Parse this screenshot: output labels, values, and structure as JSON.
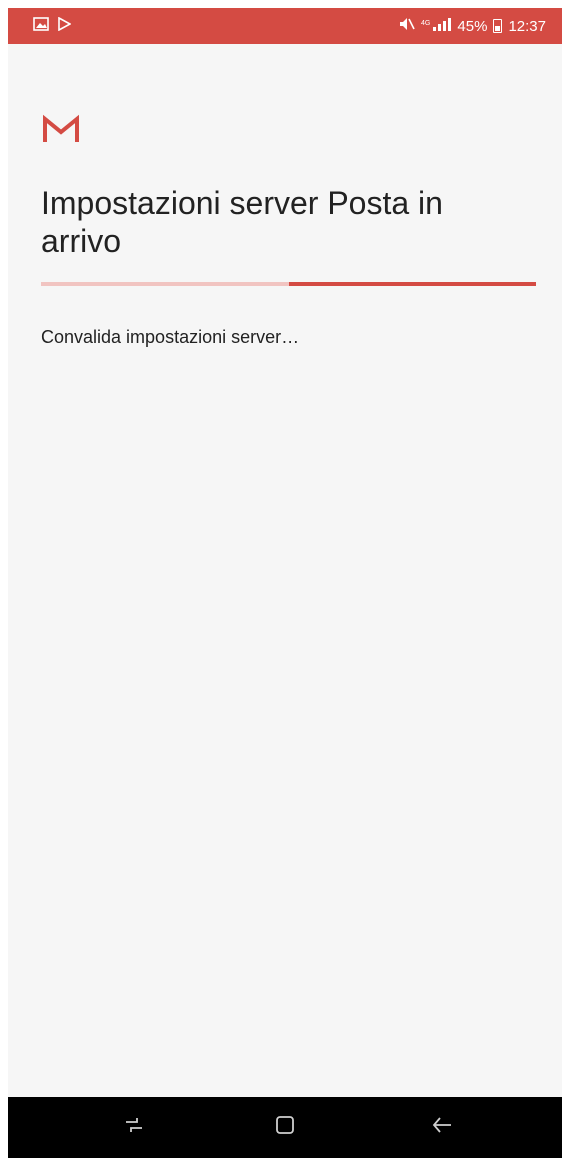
{
  "status_bar": {
    "left_icons": [
      "gallery-icon",
      "play-store-icon"
    ],
    "right_icons": [
      "mute-icon",
      "signal-icon",
      "battery-icon"
    ],
    "battery": "45%",
    "time": "12:37",
    "background_color": "#d44b43"
  },
  "header": {
    "logo": "gmail-logo-icon",
    "title": "Impostazioni server Posta in arrivo"
  },
  "progress": {
    "fraction": 0.5,
    "track_color": "#f1c4c1",
    "fill_color": "#d44b43"
  },
  "main": {
    "status_text": "Convalida impostazioni server…"
  },
  "nav_bar": {
    "buttons": [
      "recent-apps-icon",
      "home-icon",
      "back-icon"
    ]
  }
}
